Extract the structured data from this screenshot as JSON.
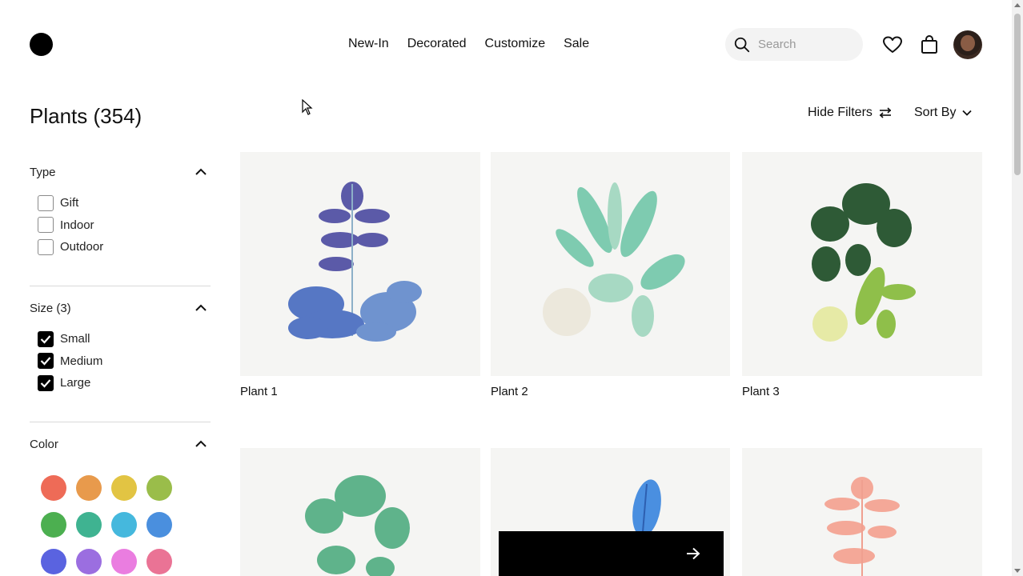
{
  "nav": {
    "items": [
      "New-In",
      "Decorated",
      "Customize",
      "Sale"
    ]
  },
  "search": {
    "placeholder": "Search",
    "icon": "search-icon"
  },
  "header_icons": {
    "wishlist": "heart-icon",
    "cart": "bag-icon",
    "profile": "avatar"
  },
  "page": {
    "title": "Plants (354)"
  },
  "toolbar": {
    "hide_filters_label": "Hide Filters",
    "sort_by_label": "Sort By"
  },
  "filters": {
    "type": {
      "label": "Type",
      "options": [
        {
          "label": "Gift",
          "checked": false
        },
        {
          "label": "Indoor",
          "checked": false
        },
        {
          "label": "Outdoor",
          "checked": false
        }
      ]
    },
    "size": {
      "label": "Size (3)",
      "options": [
        {
          "label": "Small",
          "checked": true
        },
        {
          "label": "Medium",
          "checked": true
        },
        {
          "label": "Large",
          "checked": true
        }
      ]
    },
    "color": {
      "label": "Color",
      "swatches": [
        "#ee6b57",
        "#e89a4c",
        "#e2c443",
        "#9abd4a",
        "#4caf50",
        "#3fb391",
        "#45b8dd",
        "#4a8fde",
        "#5a63e0",
        "#9b6ee0",
        "#ea7de0",
        "#ea7395"
      ]
    }
  },
  "products": [
    {
      "name": "Plant 1"
    },
    {
      "name": "Plant 2"
    },
    {
      "name": "Plant 3"
    },
    {
      "name": ""
    },
    {
      "name": ""
    },
    {
      "name": ""
    }
  ],
  "colors": {
    "accent": "#000000",
    "card_bg": "#f5f5f3"
  }
}
